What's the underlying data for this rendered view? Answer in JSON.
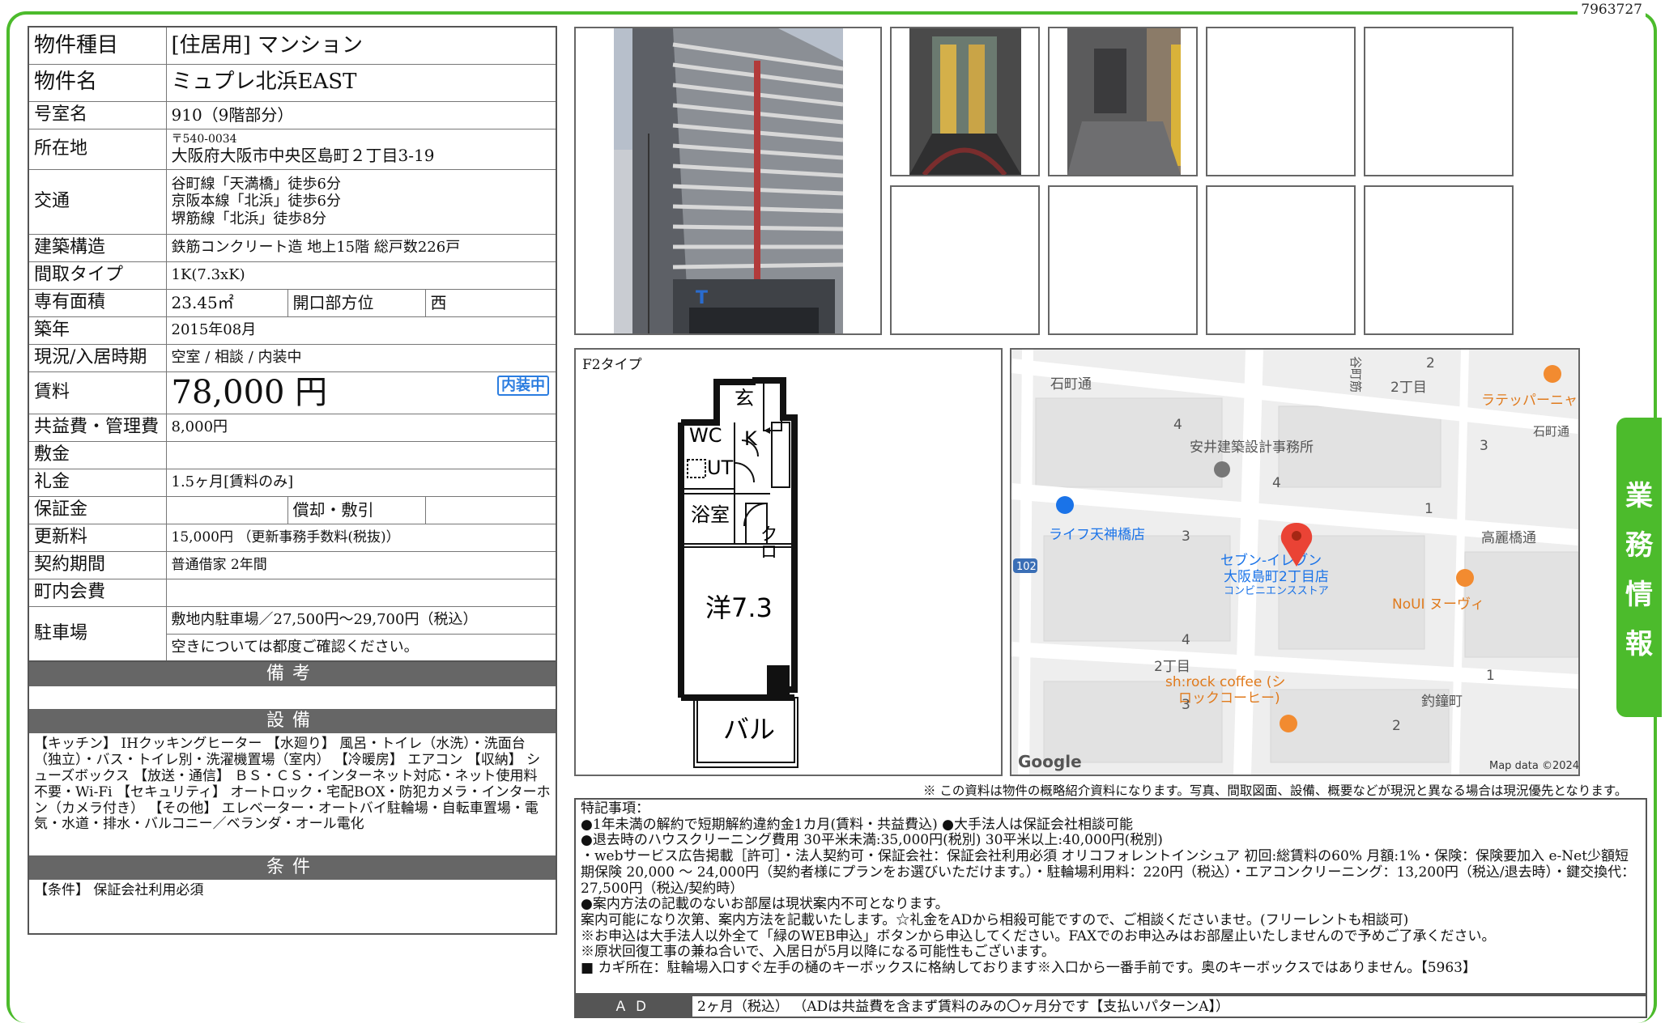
{
  "doc_id": "7963727",
  "spec": {
    "type_label": "物件種目",
    "type_value": "[住居用] マンション",
    "name_label": "物件名",
    "name_value": "ミュプレ北浜EAST",
    "room_label": "号室名",
    "room_value": "910（9階部分）",
    "address_label": "所在地",
    "postal": "〒540-0034",
    "address": "大阪府大阪市中央区島町２丁目3-19",
    "access_label": "交通",
    "access": [
      "谷町線「天満橋」徒歩6分",
      "京阪本線「北浜」徒歩6分",
      "堺筋線「北浜」徒歩8分"
    ],
    "structure_label": "建築構造",
    "structure_value": "鉄筋コンクリート造 地上15階 総戸数226戸",
    "layout_label": "間取タイプ",
    "layout_value": "1K(7.3xK)",
    "area_label": "専有面積",
    "area_value": "23.45㎡",
    "orientation_label": "開口部方位",
    "orientation_value": "西",
    "built_label": "築年",
    "built_value": "2015年08月",
    "status_label": "現況/入居時期",
    "status_value": "空室 / 相談 / 内装中",
    "rent_label": "賃料",
    "rent_value": "78,000 円",
    "rent_badge": "内装中",
    "fee_label": "共益費・管理費",
    "fee_value": "8,000円",
    "deposit_label": "敷金",
    "deposit_value": "",
    "key_money_label": "礼金",
    "key_money_value": "1.5ヶ月[賃料のみ]",
    "guarantee_label": "保証金",
    "guarantee_value": "",
    "amort_label": "償却・敷引",
    "amort_value": "",
    "renewal_label": "更新料",
    "renewal_value": "15,000円 （更新事務手数料(税抜)）",
    "contract_label": "契約期間",
    "contract_value": "普通借家 2年間",
    "town_fee_label": "町内会費",
    "town_fee_value": "",
    "parking_label": "駐車場",
    "parking_value_1": "敷地内駐車場／27,500円～29,700円（税込）",
    "parking_value_2": "空きについては都度ご確認ください。"
  },
  "remarks_head": "備考",
  "remarks_text": "",
  "equipment_head": "設備",
  "equipment_text": "【キッチン】 IHクッキングヒーター 【水廻り】 風呂・トイレ（水洗）・洗面台（独立）・バス・トイレ別・洗濯機置場（室内） 【冷暖房】 エアコン 【収納】 シューズボックス 【放送・通信】 ＢＳ・ＣＳ・インターネット対応・ネット使用料不要・Wi-Fi 【セキュリティ】 オートロック・宅配BOX・防犯カメラ・インターホン（カメラ付き） 【その他】 エレベーター・オートバイ駐輪場・自転車置場・電気・水道・排水・バルコニー／ベランダ・オール電化",
  "conditions_head": "条件",
  "conditions_text": "【条件】 保証会社利用必須",
  "floorplan": {
    "type_label": "F2タイプ",
    "rooms": {
      "entrance": "玄",
      "kitchen": "K",
      "wc": "WC",
      "ut": "UT",
      "bath": "浴室",
      "closet": "クロ",
      "western": "洋7.3",
      "balcony": "バル"
    }
  },
  "map": {
    "labels": [
      "石町通",
      "谷町筋",
      "2丁目",
      "ラテッパーニャ",
      "石町通",
      "安井建築設計事務所",
      "ライフ天神橋店",
      "高麗橋通",
      "セブン-イレブン",
      "大阪島町2丁目店",
      "コンビニエンスストア",
      "NoUI ヌーヴィ",
      "sh:rock coffee (シ",
      "ロックコーヒー)",
      "2丁目",
      "釣鐘町",
      "102"
    ],
    "numbers": [
      "2",
      "4",
      "3",
      "4",
      "1",
      "3",
      "4",
      "3",
      "1",
      "2"
    ],
    "google": "Google",
    "attribution": "Map data ©2024"
  },
  "disclaimer": "※ この資料は物件の概略紹介資料になります。写真、間取図面、設備、概要などが現況と異なる場合は現況優先となります。",
  "special_notes": [
    "特記事項：",
    "●1年未満の解約で短期解約違約金1カ月(賃料・共益費込) ●大手法人は保証会社相談可能",
    "●退去時のハウスクリーニング費用 30平米未満:35,000円(税別) 30平米以上:40,000円(税別)",
    "・webサービス広告掲載［許可］・法人契約可・保証会社：保証会社利用必須 オリコフォレントインシュア 初回:総賃料の60% 月額:1%・保険：保険要加入 e-Net少額短期保険 20,000 ～ 24,000円（契約者様にプランをお選びいただけます。）・駐輪場利用料：220円（税込）・エアコンクリーニング：13,200円（税込/退去時）・鍵交換代：27,500円（税込/契約時）",
    "●案内方法の記載のないお部屋は現状案内不可となります。",
    "案内可能になり次第、案内方法を記載いたします。☆礼金をADから相殺可能ですので、ご相談くださいませ。(フリーレントも相談可)",
    "※お申込は大手法人以外全て「緑のWEB申込」ボタンから申込してください。FAXでのお申込みはお部屋止いたしませんので予めご了承ください。",
    "※原状回復工事の兼ね合いで、入居日が5月以降になる可能性もございます。",
    "■ カギ所在：駐輪場入口すぐ左手の樋のキーボックスに格納しております※入口から一番手前です。奥のキーボックスではありません。【5963】"
  ],
  "ad": {
    "label": "ＡＤ",
    "value": "2ヶ月（税込） （ADは共益費を含まず賃料のみの〇ヶ月分です【支払いパターンA】）"
  },
  "side_tab": [
    "業",
    "務",
    "情",
    "報"
  ]
}
